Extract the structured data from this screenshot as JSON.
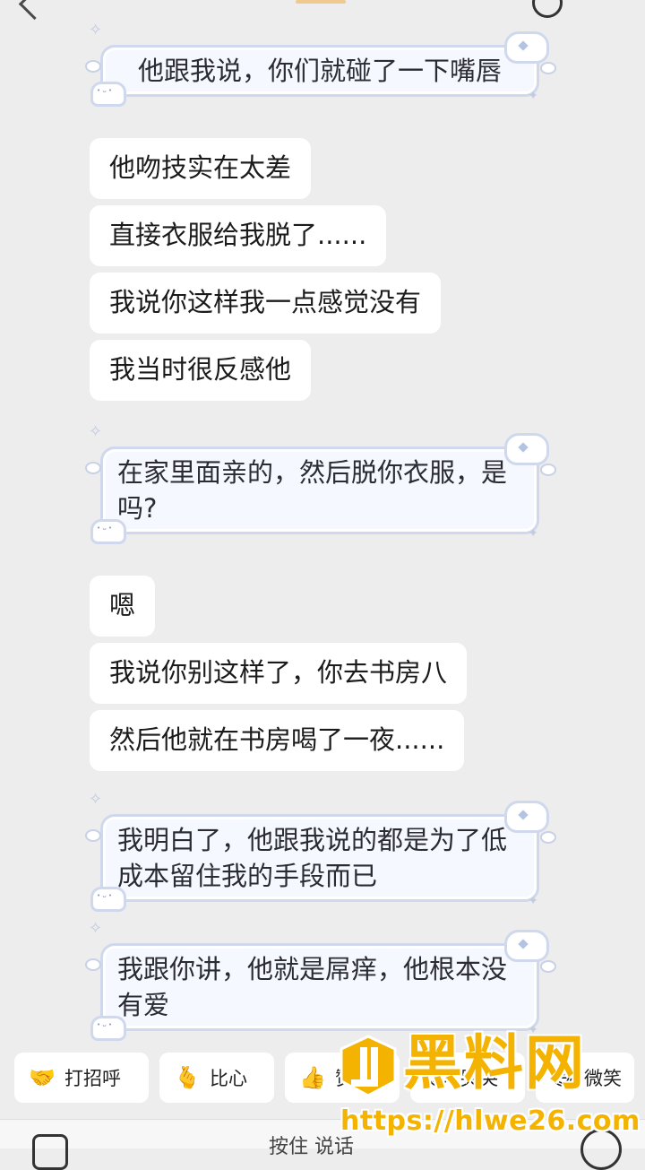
{
  "messages": [
    {
      "side": "self",
      "style": "sticker",
      "text": "他跟我说，你们就碰了一下嘴唇"
    },
    {
      "side": "other",
      "text": "他吻技实在太差"
    },
    {
      "side": "other",
      "text": "直接衣服给我脱了......"
    },
    {
      "side": "other",
      "text": "我说你这样我一点感觉没有"
    },
    {
      "side": "other",
      "text": "我当时很反感他"
    },
    {
      "side": "self",
      "style": "sticker",
      "text": "在家里面亲的，然后脱你衣服，是吗?"
    },
    {
      "side": "other",
      "text": "嗯"
    },
    {
      "side": "other",
      "text": "我说你别这样了，你去书房八"
    },
    {
      "side": "other",
      "text": "然后他就在书房喝了一夜......"
    },
    {
      "side": "self",
      "style": "sticker",
      "text": "我明白了，他跟我说的都是为了低成本留住我的手段而已"
    },
    {
      "side": "self",
      "style": "sticker",
      "text": "我跟你讲，他就是屌痒，他根本没有爱"
    }
  ],
  "quick_replies": [
    {
      "emoji": "🤝",
      "label": "打招呼"
    },
    {
      "emoji": "🫰",
      "label": "比心"
    },
    {
      "emoji": "👍",
      "label": "赞"
    },
    {
      "emoji": "😢",
      "label": "哭哭"
    },
    {
      "emoji": "😄",
      "label": "微笑"
    }
  ],
  "input": {
    "hint": "按住 说话"
  },
  "watermark": {
    "title": "黑料网",
    "url": "https://hlwe26.com"
  },
  "colors": {
    "background": "#ededed",
    "bubble_other": "#ffffff",
    "bubble_self": "#f6f8ff",
    "bubble_self_border": "#cfd8ec",
    "watermark": "#f3b300"
  }
}
